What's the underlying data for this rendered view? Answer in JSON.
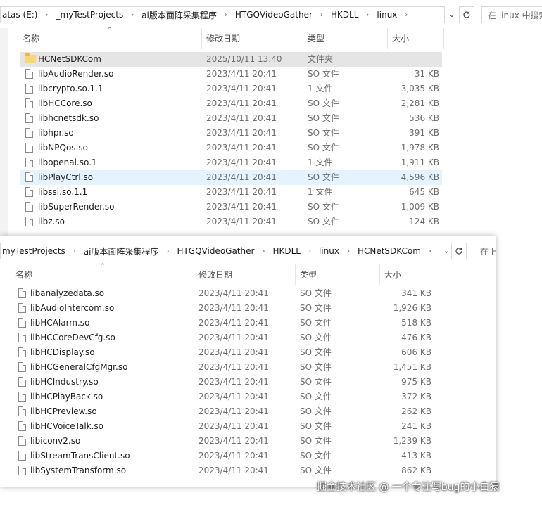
{
  "window1": {
    "breadcrumb": [
      "atas (E:)",
      "_myTestProjects",
      "ai版本面阵采集程序",
      "HTGQVideoGather",
      "HKDLL",
      "linux"
    ],
    "search_placeholder": "在 linux 中搜索",
    "columns": {
      "name": "名称",
      "date": "修改日期",
      "type": "类型",
      "size": "大小"
    },
    "rows": [
      {
        "name": "HCNetSDKCom",
        "date": "2025/10/11 13:40",
        "type": "文件夹",
        "size": "",
        "icon": "folder-icon"
      },
      {
        "name": "libAudioRender.so",
        "date": "2023/4/11 20:41",
        "type": "SO 文件",
        "size": "31 KB",
        "icon": "file-icon"
      },
      {
        "name": "libcrypto.so.1.1",
        "date": "2023/4/11 20:41",
        "type": "1 文件",
        "size": "3,035 KB",
        "icon": "file-icon"
      },
      {
        "name": "libHCCore.so",
        "date": "2023/4/11 20:41",
        "type": "SO 文件",
        "size": "2,281 KB",
        "icon": "file-icon"
      },
      {
        "name": "libhcnetsdk.so",
        "date": "2023/4/11 20:41",
        "type": "SO 文件",
        "size": "536 KB",
        "icon": "file-icon"
      },
      {
        "name": "libhpr.so",
        "date": "2023/4/11 20:41",
        "type": "SO 文件",
        "size": "391 KB",
        "icon": "file-icon"
      },
      {
        "name": "libNPQos.so",
        "date": "2023/4/11 20:41",
        "type": "SO 文件",
        "size": "1,978 KB",
        "icon": "file-icon"
      },
      {
        "name": "libopenal.so.1",
        "date": "2023/4/11 20:41",
        "type": "1 文件",
        "size": "1,911 KB",
        "icon": "file-icon"
      },
      {
        "name": "libPlayCtrl.so",
        "date": "2023/4/11 20:41",
        "type": "SO 文件",
        "size": "4,596 KB",
        "icon": "file-icon"
      },
      {
        "name": "libssl.so.1.1",
        "date": "2023/4/11 20:41",
        "type": "1 文件",
        "size": "645 KB",
        "icon": "file-icon"
      },
      {
        "name": "libSuperRender.so",
        "date": "2023/4/11 20:41",
        "type": "SO 文件",
        "size": "1,009 KB",
        "icon": "file-icon"
      },
      {
        "name": "libz.so",
        "date": "2023/4/11 20:41",
        "type": "SO 文件",
        "size": "124 KB",
        "icon": "file-icon"
      }
    ]
  },
  "window2": {
    "breadcrumb": [
      "myTestProjects",
      "ai版本面阵采集程序",
      "HTGQVideoGather",
      "HKDLL",
      "linux",
      "HCNetSDKCom"
    ],
    "search_placeholder": "在 H",
    "columns": {
      "name": "名称",
      "date": "修改日期",
      "type": "类型",
      "size": "大小"
    },
    "rows": [
      {
        "name": "libanalyzedata.so",
        "date": "2023/4/11 20:41",
        "type": "SO 文件",
        "size": "341 KB"
      },
      {
        "name": "libAudioIntercom.so",
        "date": "2023/4/11 20:41",
        "type": "SO 文件",
        "size": "1,926 KB"
      },
      {
        "name": "libHCAlarm.so",
        "date": "2023/4/11 20:41",
        "type": "SO 文件",
        "size": "518 KB"
      },
      {
        "name": "libHCCoreDevCfg.so",
        "date": "2023/4/11 20:41",
        "type": "SO 文件",
        "size": "476 KB"
      },
      {
        "name": "libHCDisplay.so",
        "date": "2023/4/11 20:41",
        "type": "SO 文件",
        "size": "606 KB"
      },
      {
        "name": "libHCGeneralCfgMgr.so",
        "date": "2023/4/11 20:41",
        "type": "SO 文件",
        "size": "1,451 KB"
      },
      {
        "name": "libHCIndustry.so",
        "date": "2023/4/11 20:41",
        "type": "SO 文件",
        "size": "975 KB"
      },
      {
        "name": "libHCPlayBack.so",
        "date": "2023/4/11 20:41",
        "type": "SO 文件",
        "size": "372 KB"
      },
      {
        "name": "libHCPreview.so",
        "date": "2023/4/11 20:41",
        "type": "SO 文件",
        "size": "262 KB"
      },
      {
        "name": "libHCVoiceTalk.so",
        "date": "2023/4/11 20:41",
        "type": "SO 文件",
        "size": "241 KB"
      },
      {
        "name": "libiconv2.so",
        "date": "2023/4/11 20:41",
        "type": "SO 文件",
        "size": "1,239 KB"
      },
      {
        "name": "libStreamTransClient.so",
        "date": "2023/4/11 20:41",
        "type": "SO 文件",
        "size": "413 KB"
      },
      {
        "name": "libSystemTransform.so",
        "date": "2023/4/11 20:41",
        "type": "SO 文件",
        "size": "862 KB"
      }
    ]
  },
  "watermark": "掘金技术社区 @ 一个专注写bug的小白猿"
}
